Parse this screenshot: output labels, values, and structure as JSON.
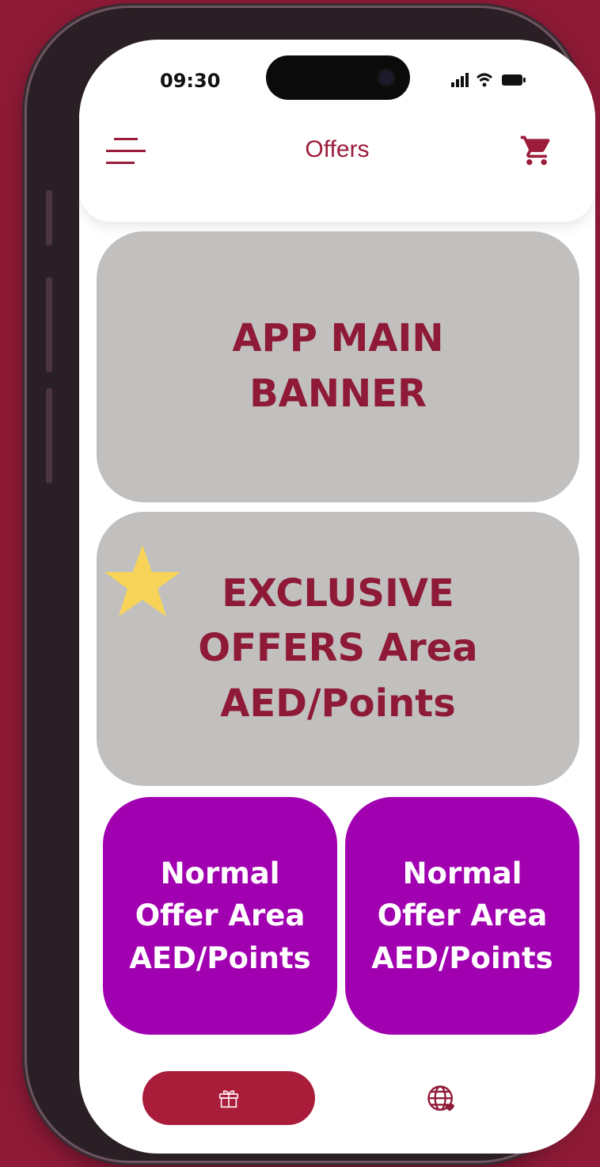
{
  "status_bar": {
    "time": "09:30"
  },
  "header": {
    "title": "Offers"
  },
  "icons": {
    "menu": "menu-icon",
    "cart": "cart-icon",
    "star": "star-icon",
    "gift": "gift-icon",
    "globe": "globe-icon"
  },
  "banner": {
    "line1": "APP MAIN",
    "line2": "BANNER"
  },
  "exclusive": {
    "line1": "EXCLUSIVE",
    "line2": "OFFERS Area",
    "line3": "AED/Points"
  },
  "offers": [
    {
      "line1": "Normal",
      "line2": "Offer Area",
      "line3": "AED/Points"
    },
    {
      "line1": "Normal",
      "line2": "Offer Area",
      "line3": "AED/Points"
    }
  ],
  "colors": {
    "brand": "#8e1a37",
    "accent": "#a91c3a",
    "card_gray": "#c2c0bf",
    "offer_purple": "#a100b0",
    "star": "#f7d457"
  }
}
